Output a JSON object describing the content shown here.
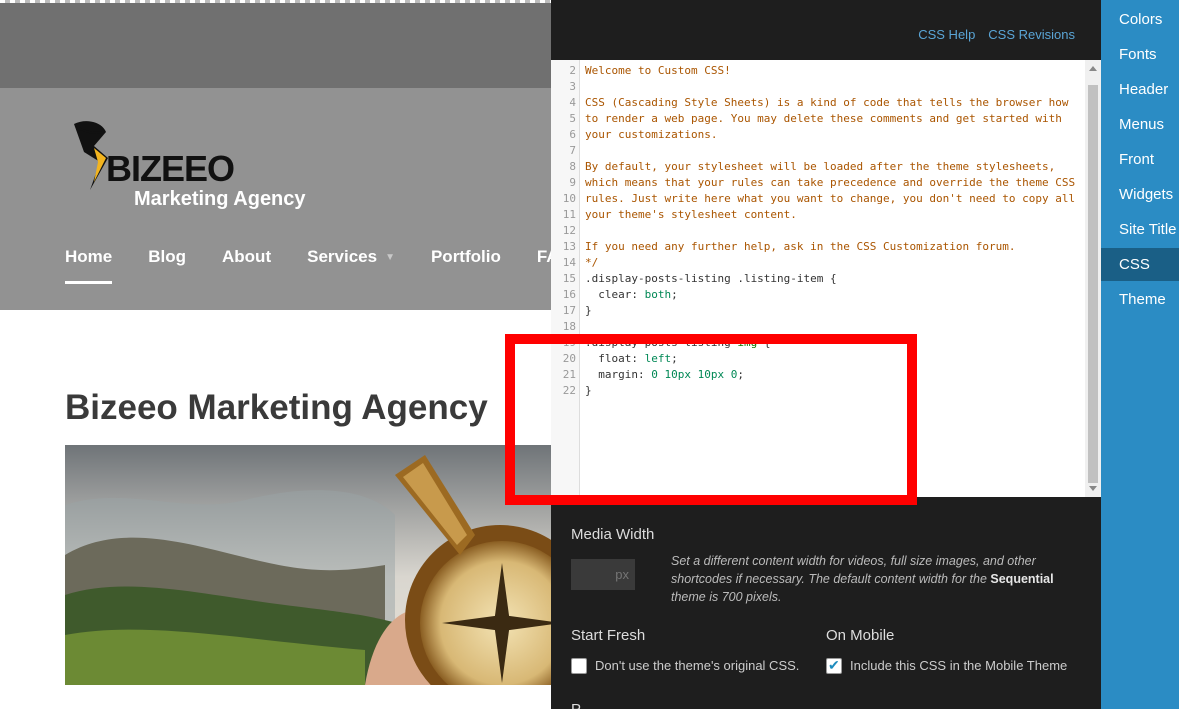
{
  "site": {
    "logo_text": "BIZEEO",
    "logo_sub": "Marketing Agency",
    "nav": [
      {
        "label": "Home",
        "active": true
      },
      {
        "label": "Blog"
      },
      {
        "label": "About"
      },
      {
        "label": "Services",
        "has_dropdown": true
      },
      {
        "label": "Portfolio"
      },
      {
        "label": "FA"
      }
    ],
    "page_title": "Bizeeo Marketing Agency"
  },
  "panel": {
    "links": [
      "CSS Help",
      "CSS Revisions"
    ],
    "code": [
      {
        "n": "2",
        "parts": [
          {
            "t": "Welcome to Custom CSS!",
            "c": "cmt"
          }
        ]
      },
      {
        "n": "3",
        "parts": []
      },
      {
        "n": "4",
        "parts": [
          {
            "t": "CSS (Cascading Style Sheets) is a kind of code that tells the browser how",
            "c": "cmt"
          }
        ]
      },
      {
        "n": "5",
        "parts": [
          {
            "t": "to render a web page. You may delete these comments and get started with",
            "c": "cmt"
          }
        ]
      },
      {
        "n": "6",
        "parts": [
          {
            "t": "your customizations.",
            "c": "cmt"
          }
        ]
      },
      {
        "n": "7",
        "parts": []
      },
      {
        "n": "8",
        "parts": [
          {
            "t": "By default, your stylesheet will be loaded after the theme stylesheets,",
            "c": "cmt"
          }
        ]
      },
      {
        "n": "9",
        "parts": [
          {
            "t": "which means that your rules can take precedence and override the theme CSS",
            "c": "cmt"
          }
        ]
      },
      {
        "n": "10",
        "parts": [
          {
            "t": "rules. Just write here what you want to change, you don't need to copy all",
            "c": "cmt"
          }
        ]
      },
      {
        "n": "11",
        "parts": [
          {
            "t": "your theme's stylesheet content.",
            "c": "cmt"
          }
        ]
      },
      {
        "n": "12",
        "parts": []
      },
      {
        "n": "13",
        "parts": [
          {
            "t": "If you need any further help, ask in the CSS Customization forum.",
            "c": "cmt"
          }
        ]
      },
      {
        "n": "14",
        "parts": [
          {
            "t": "*/",
            "c": "cmt"
          }
        ]
      },
      {
        "n": "15",
        "parts": [
          {
            "t": ".display-posts-listing .listing-item {",
            "c": "sel"
          }
        ]
      },
      {
        "n": "16",
        "parts": [
          {
            "t": "  clear: ",
            "c": "prop"
          },
          {
            "t": "both",
            "c": "val"
          },
          {
            "t": ";",
            "c": "prop"
          }
        ]
      },
      {
        "n": "17",
        "parts": [
          {
            "t": "}",
            "c": "sel"
          }
        ]
      },
      {
        "n": "18",
        "parts": []
      },
      {
        "n": "19",
        "parts": [
          {
            "t": ".display-posts-listing ",
            "c": "sel"
          },
          {
            "t": "img",
            "c": "tag"
          },
          {
            "t": " {",
            "c": "sel"
          }
        ]
      },
      {
        "n": "20",
        "parts": [
          {
            "t": "  float: ",
            "c": "prop"
          },
          {
            "t": "left",
            "c": "val"
          },
          {
            "t": ";",
            "c": "prop"
          }
        ]
      },
      {
        "n": "21",
        "parts": [
          {
            "t": "  margin: ",
            "c": "prop"
          },
          {
            "t": "0 10px 10px 0",
            "c": "val"
          },
          {
            "t": ";",
            "c": "prop"
          }
        ]
      },
      {
        "n": "22",
        "parts": [
          {
            "t": "}",
            "c": "sel"
          }
        ]
      }
    ],
    "media_width": {
      "label": "Media Width",
      "placeholder": "px",
      "desc_before": "Set a different content width for videos, full size images, and other shortcodes if necessary. The default content width for the ",
      "desc_theme": "Sequential",
      "desc_after": " theme is 700 pixels."
    },
    "start_fresh": {
      "label": "Start Fresh",
      "checkbox_label": "Don't use the theme's original CSS.",
      "checked": false
    },
    "on_mobile": {
      "label": "On Mobile",
      "checkbox_label": "Include this CSS in the Mobile Theme",
      "checked": true
    },
    "cut_label": "P..."
  },
  "menu": {
    "items": [
      {
        "label": "Colors"
      },
      {
        "label": "Fonts"
      },
      {
        "label": "Header"
      },
      {
        "label": "Menus"
      },
      {
        "label": "Front"
      },
      {
        "label": "Widgets"
      },
      {
        "label": "Site Title"
      },
      {
        "label": "CSS",
        "active": true
      },
      {
        "label": "Theme"
      }
    ]
  },
  "colors": {
    "menu_bg": "#2b8cc4",
    "menu_active": "#1a5f86",
    "panel_bg": "#1e1e1e",
    "annotation": "#ff0000",
    "link": "#5aa5d6"
  }
}
